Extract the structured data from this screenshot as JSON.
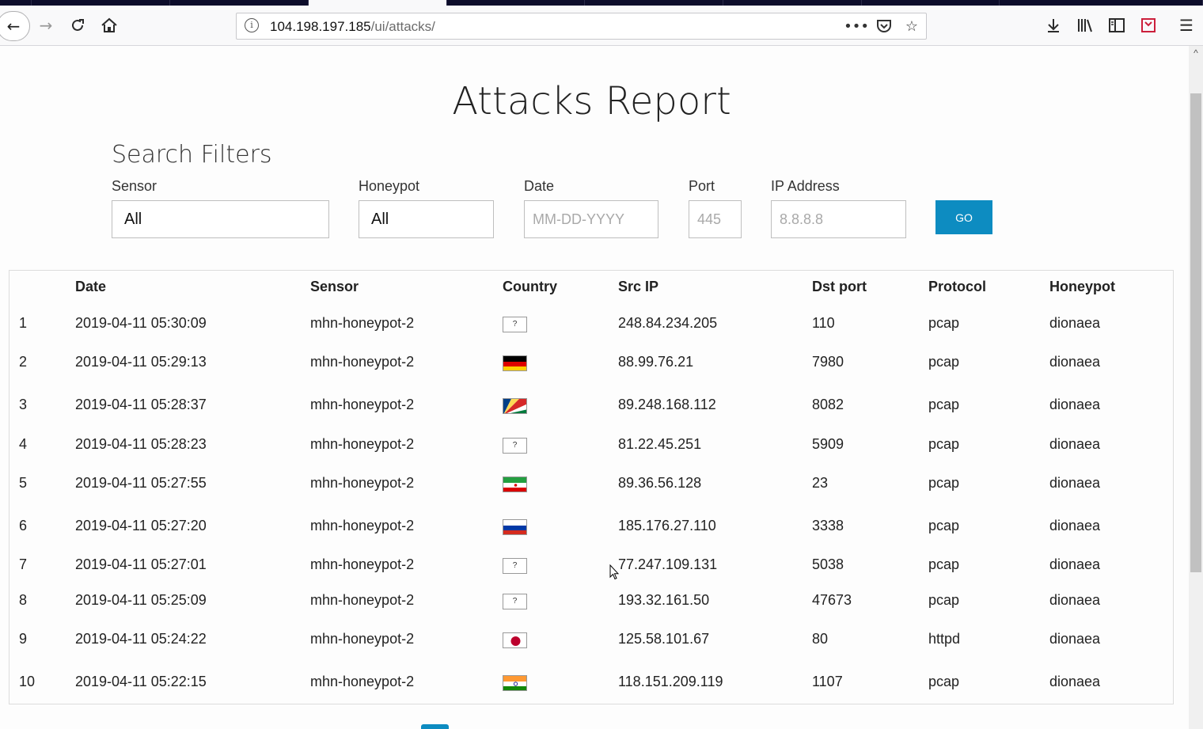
{
  "browser": {
    "url_host": "104.198.197.185",
    "url_path": "/ui/attacks/",
    "info_icon": "info-icon",
    "icons": [
      "back-icon",
      "forward-icon",
      "reload-icon",
      "home-icon",
      "more-icon",
      "pocket-icon",
      "bookmark-star-icon",
      "download-icon",
      "library-icon",
      "sidebar-icon",
      "shield-icon",
      "menu-icon"
    ]
  },
  "page": {
    "title": "Attacks Report",
    "filters_title": "Search Filters"
  },
  "filters": {
    "sensor": {
      "label": "Sensor",
      "value": "All"
    },
    "honeypot": {
      "label": "Honeypot",
      "value": "All"
    },
    "date": {
      "label": "Date",
      "placeholder": "MM-DD-YYYY"
    },
    "port": {
      "label": "Port",
      "placeholder": "445"
    },
    "ip": {
      "label": "IP Address",
      "placeholder": "8.8.8.8"
    },
    "go_label": "GO"
  },
  "table": {
    "headers": [
      "Date",
      "Sensor",
      "Country",
      "Src IP",
      "Dst port",
      "Protocol",
      "Honeypot"
    ],
    "rows": [
      {
        "n": "1",
        "date": "2019-04-11 05:30:09",
        "sensor": "mhn-honeypot-2",
        "country": "unknown",
        "ip": "248.84.234.205",
        "port": "110",
        "protocol": "pcap",
        "honeypot": "dionaea"
      },
      {
        "n": "2",
        "date": "2019-04-11 05:29:13",
        "sensor": "mhn-honeypot-2",
        "country": "de",
        "ip": "88.99.76.21",
        "port": "7980",
        "protocol": "pcap",
        "honeypot": "dionaea"
      },
      {
        "n": "3",
        "date": "2019-04-11 05:28:37",
        "sensor": "mhn-honeypot-2",
        "country": "sc",
        "ip": "89.248.168.112",
        "port": "8082",
        "protocol": "pcap",
        "honeypot": "dionaea"
      },
      {
        "n": "4",
        "date": "2019-04-11 05:28:23",
        "sensor": "mhn-honeypot-2",
        "country": "unknown",
        "ip": "81.22.45.251",
        "port": "5909",
        "protocol": "pcap",
        "honeypot": "dionaea"
      },
      {
        "n": "5",
        "date": "2019-04-11 05:27:55",
        "sensor": "mhn-honeypot-2",
        "country": "ir",
        "ip": "89.36.56.128",
        "port": "23",
        "protocol": "pcap",
        "honeypot": "dionaea"
      },
      {
        "n": "6",
        "date": "2019-04-11 05:27:20",
        "sensor": "mhn-honeypot-2",
        "country": "ru",
        "ip": "185.176.27.110",
        "port": "3338",
        "protocol": "pcap",
        "honeypot": "dionaea"
      },
      {
        "n": "7",
        "date": "2019-04-11 05:27:01",
        "sensor": "mhn-honeypot-2",
        "country": "unknown",
        "ip": "77.247.109.131",
        "port": "5038",
        "protocol": "pcap",
        "honeypot": "dionaea"
      },
      {
        "n": "8",
        "date": "2019-04-11 05:25:09",
        "sensor": "mhn-honeypot-2",
        "country": "unknown",
        "ip": "193.32.161.50",
        "port": "47673",
        "protocol": "pcap",
        "honeypot": "dionaea"
      },
      {
        "n": "9",
        "date": "2019-04-11 05:24:22",
        "sensor": "mhn-honeypot-2",
        "country": "jp",
        "ip": "125.58.101.67",
        "port": "80",
        "protocol": "httpd",
        "honeypot": "dionaea"
      },
      {
        "n": "10",
        "date": "2019-04-11 05:22:15",
        "sensor": "mhn-honeypot-2",
        "country": "in",
        "ip": "118.151.209.119",
        "port": "1107",
        "protocol": "pcap",
        "honeypot": "dionaea"
      }
    ]
  },
  "unknown_flag_glyph": "?",
  "colors": {
    "accent": "#0d8cc1",
    "tabbar": "#0c0c2a"
  }
}
